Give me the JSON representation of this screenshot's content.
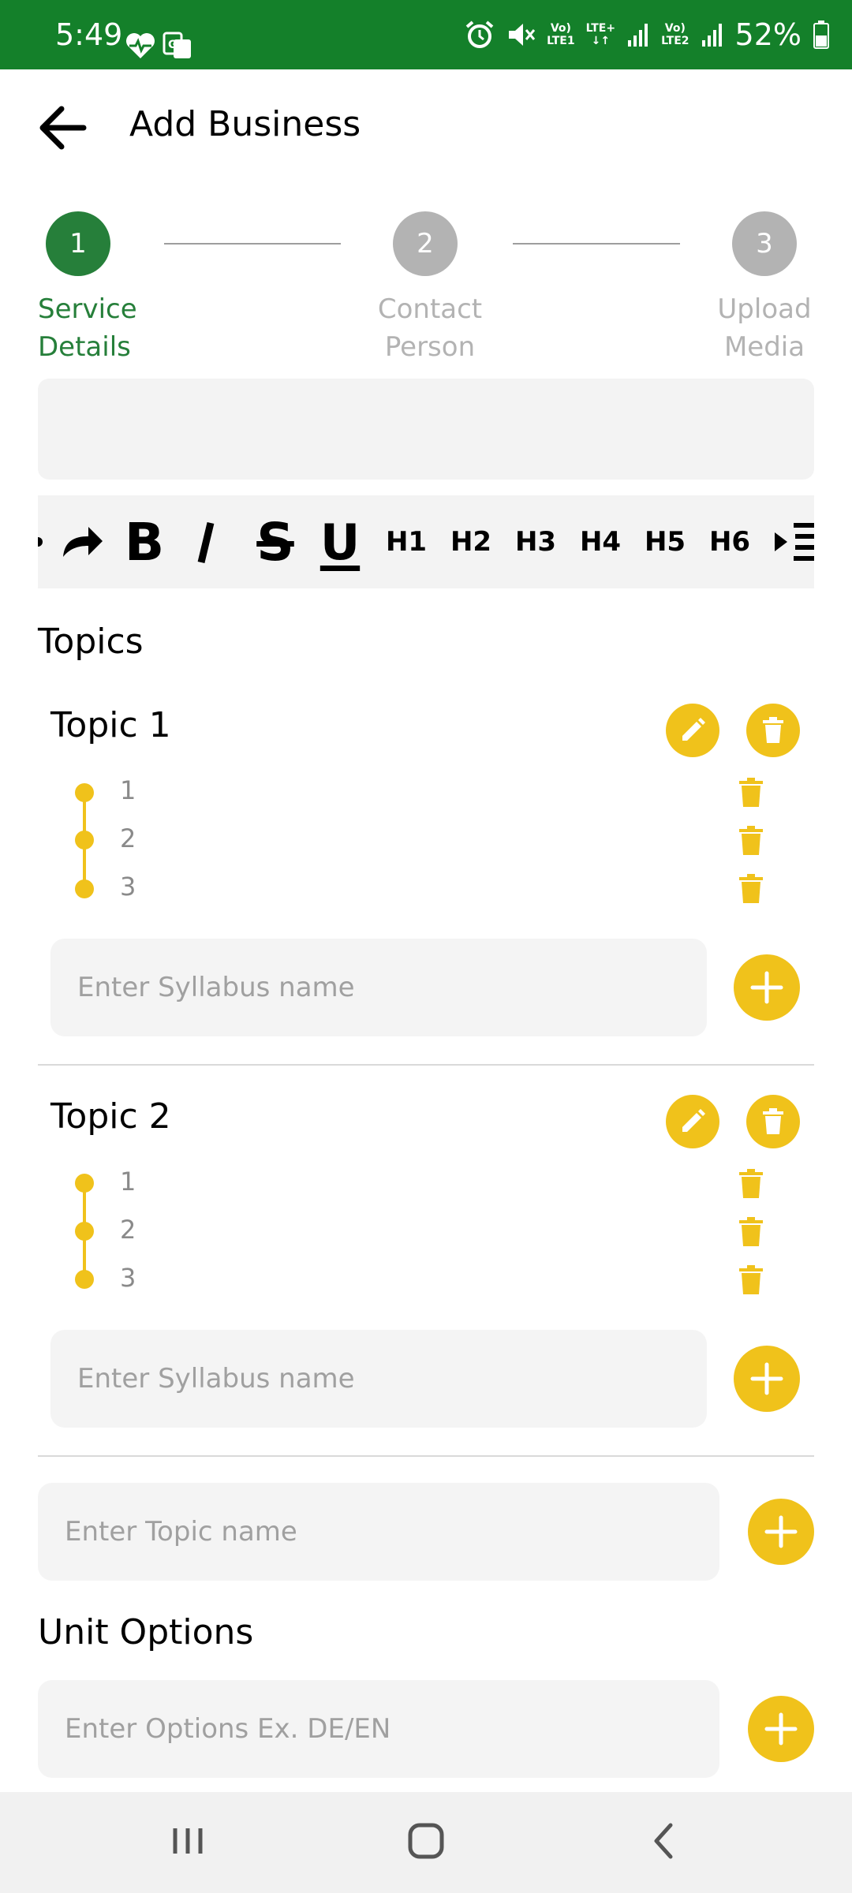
{
  "status_bar": {
    "time": "5:49",
    "battery": "52%",
    "lte1_top": "Vo)",
    "lte1_bottom": "LTE1",
    "lte_plus": "LTE+",
    "lte2_top": "Vo)",
    "lte2_bottom": "LTE2",
    "bg_color": "#14802a"
  },
  "app_bar": {
    "title": "Add Business",
    "back_icon": "arrow-left-icon"
  },
  "stepper": {
    "steps": [
      {
        "number": "1",
        "label_line1": "Service",
        "label_line2": "Details",
        "active": true
      },
      {
        "number": "2",
        "label_line1": "Contact",
        "label_line2": "Person",
        "active": false
      },
      {
        "number": "3",
        "label_line1": "Upload",
        "label_line2": "Media",
        "active": false
      }
    ],
    "active_color": "#267f3a",
    "inactive_color": "#b3b3b3"
  },
  "toolbar": {
    "buttons": [
      "redo-icon",
      "bold-icon",
      "italic-icon",
      "strikethrough-icon",
      "underline-icon"
    ],
    "headings": [
      "H1",
      "H2",
      "H3",
      "H4",
      "H5",
      "H6"
    ]
  },
  "topics": {
    "heading": "Topics",
    "list": [
      {
        "title": "Topic 1",
        "items": [
          "1",
          "2",
          "3"
        ],
        "input_placeholder": "Enter Syllabus name"
      },
      {
        "title": "Topic 2",
        "items": [
          "1",
          "2",
          "3"
        ],
        "input_placeholder": "Enter Syllabus name"
      }
    ],
    "new_topic_placeholder": "Enter Topic name",
    "accent_color": "#f0c21b"
  },
  "unit_options": {
    "heading": "Unit Options",
    "input_placeholder": "Enter Options Ex. DE/EN"
  }
}
